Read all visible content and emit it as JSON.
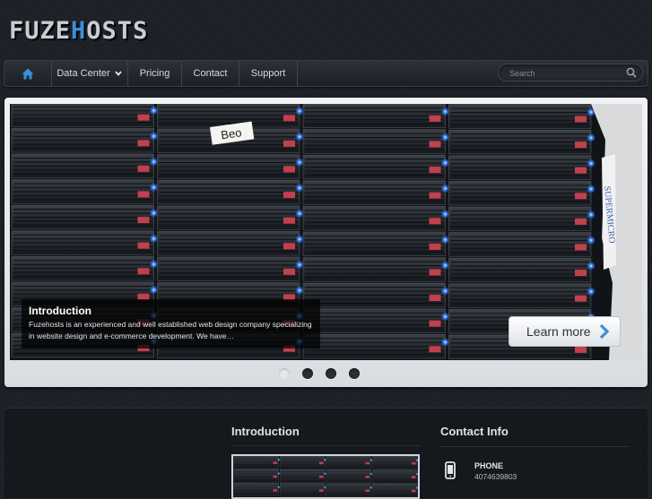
{
  "logo": {
    "part1": "FUZE",
    "accent": "H",
    "part2": "OSTS"
  },
  "nav": {
    "home_icon": "home-icon",
    "items": [
      {
        "label": "Data Center",
        "has_dropdown": true
      },
      {
        "label": "Pricing"
      },
      {
        "label": "Contact"
      },
      {
        "label": "Support"
      }
    ],
    "search_placeholder": "Search",
    "search_icon": "search-icon"
  },
  "slider": {
    "image_tag_text": "Beo",
    "rack_brand_text": "SUPERMICRO",
    "caption_title": "Introduction",
    "caption_text": "Fuzehosts is an experienced and well established web design company specializing in website design and e-commerce development. We have…",
    "button_label": "Learn more",
    "dots": 4,
    "active_dot": 1
  },
  "sections": {
    "intro_title": "Introduction",
    "contact_title": "Contact Info",
    "phone_label": "PHONE",
    "phone_value": "4074639803"
  },
  "colors": {
    "accent": "#3b8fd8",
    "background": "#1c2026",
    "panel": "#15181c"
  }
}
